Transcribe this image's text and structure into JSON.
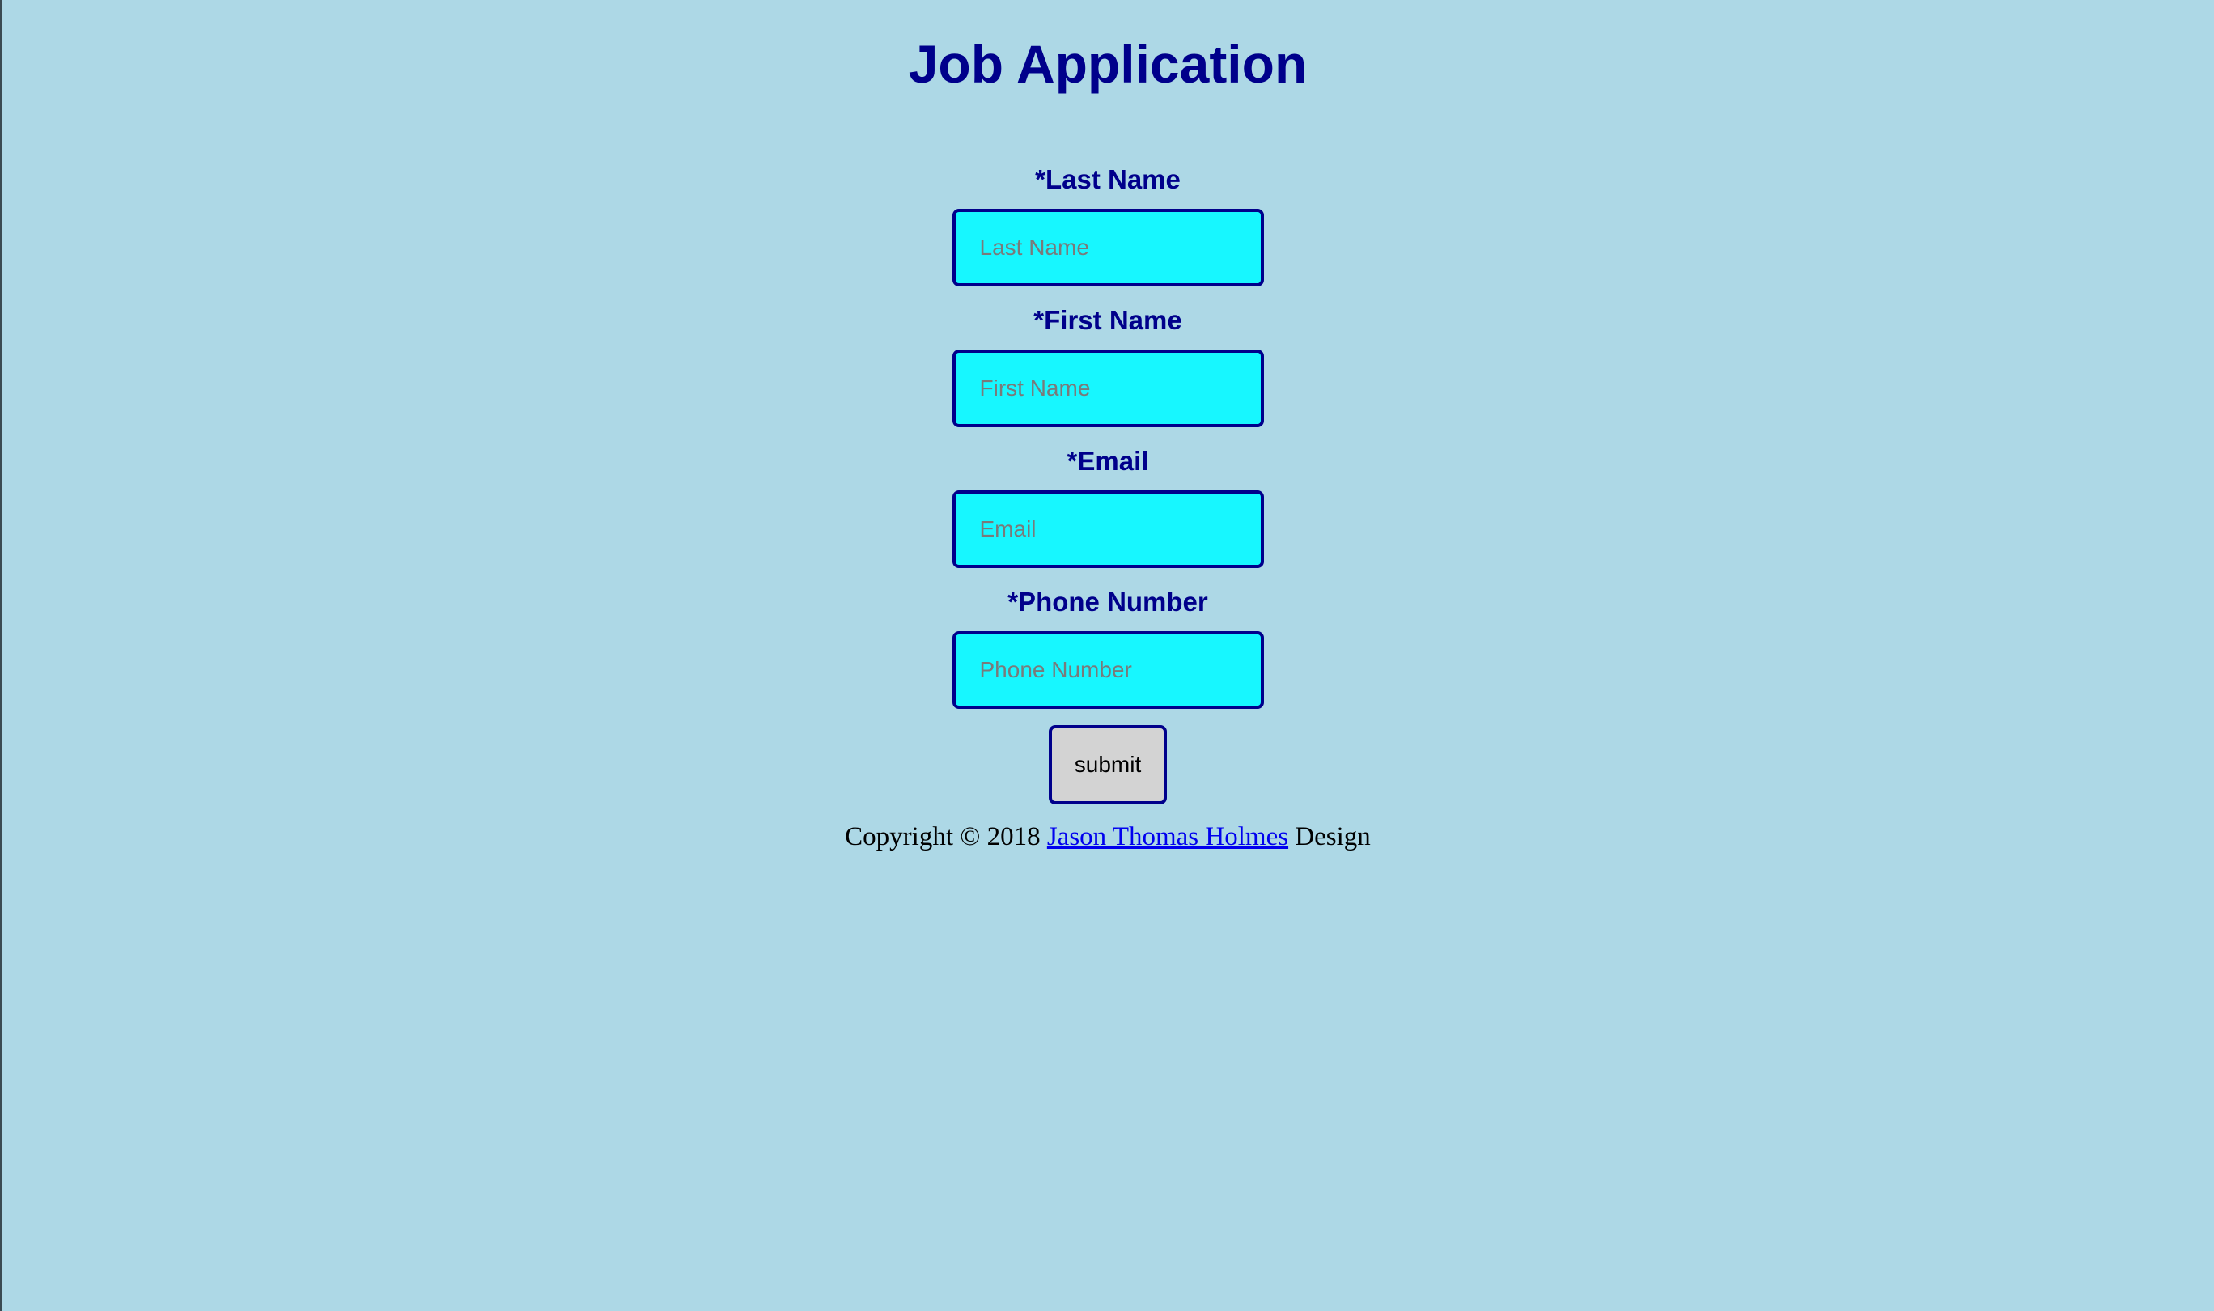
{
  "page": {
    "title": "Job Application",
    "background_color": "#add8e6",
    "accent_color": "#00008b",
    "input_color": "#17f7ff"
  },
  "form": {
    "fields": [
      {
        "label": "*Last Name",
        "placeholder": "Last Name",
        "value": ""
      },
      {
        "label": "*First Name",
        "placeholder": "First Name",
        "value": ""
      },
      {
        "label": "*Email",
        "placeholder": "Email",
        "value": ""
      },
      {
        "label": "*Phone Number",
        "placeholder": "Phone Number",
        "value": ""
      }
    ],
    "submit_label": "submit"
  },
  "footer": {
    "prefix": "Copyright © 2018",
    "link_text": "Jason Thomas Holmes",
    "suffix": "Design"
  }
}
